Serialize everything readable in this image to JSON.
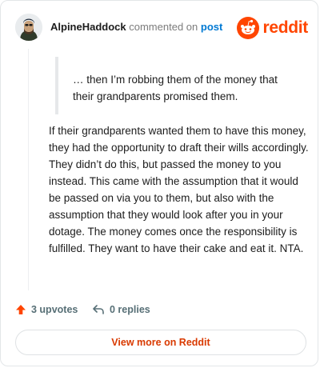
{
  "comment": {
    "author": "AlpineHaddock",
    "action": "commented on",
    "post_link": "post",
    "quote": "… then I’m robbing them of the money that their grandparents promised them.",
    "body": "If their grandparents wanted them to have this money, they had the opportunity to draft their wills accordingly. They didn’t do this, but passed the money to you instead. This came with the assumption that it would be passed on via you to them, but also with the assumption that they would look after you in your dotage. The money comes once the responsibility is fulfilled. They want to have their cake and eat it. NTA."
  },
  "brand": {
    "name": "reddit",
    "color": "#ff4500"
  },
  "stats": {
    "upvotes": "3 upvotes",
    "replies": "0 replies",
    "upvote_icon": "upvote-arrow-icon",
    "reply_icon": "reply-icon"
  },
  "footer": {
    "view_more_label": "View more on Reddit"
  },
  "colors": {
    "accent": "#ff4500",
    "link": "#0079d3",
    "button_text": "#d93a00"
  }
}
